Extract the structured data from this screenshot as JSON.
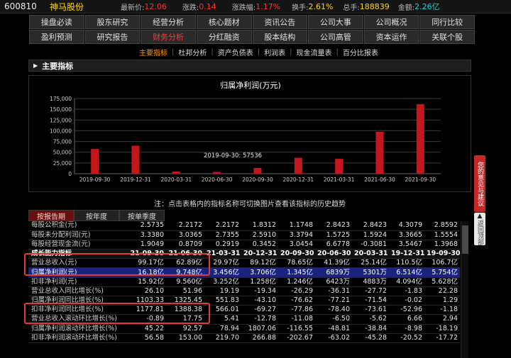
{
  "stock": {
    "code": "600810",
    "name": "神马股份",
    "price_label": "最新价:",
    "price": "12.06",
    "change_label": "涨跌:",
    "change": "0.14",
    "change_pct_label": "涨跌幅:",
    "change_pct": "1.17%",
    "turnover_label": "换手:",
    "turnover": "2.61%",
    "total_hands_label": "总手:",
    "total_hands": "188839",
    "amount_label": "金额:",
    "amount": "2.26亿"
  },
  "nav": {
    "row1": [
      "操盘必读",
      "股东研究",
      "经营分析",
      "核心题材",
      "资讯公告",
      "公司大事",
      "公司概况",
      "同行比较"
    ],
    "row2": [
      "盈利预测",
      "研究报告",
      "财务分析",
      "分红融资",
      "股本结构",
      "公司高管",
      "资本运作",
      "关联个股"
    ],
    "active": "财务分析"
  },
  "subnav": {
    "items": [
      "主要指标",
      "杜邦分析",
      "资产负债表",
      "利润表",
      "现金流量表",
      "百分比报表"
    ],
    "active": "主要指标"
  },
  "section_title": "主要指标",
  "chart_data": {
    "type": "bar",
    "title": "归属净利润(万元)",
    "categories": [
      "2019-09-30",
      "2019-12-31",
      "2020-03-31",
      "2020-06-30",
      "2020-09-30",
      "2020-12-31",
      "2021-03-31",
      "2021-06-30",
      "2021-09-30"
    ],
    "values": [
      57536,
      65000,
      5000,
      4000,
      13450,
      37060,
      34560,
      97480,
      162000
    ],
    "y_ticks": [
      "0",
      "25,000",
      "50,000",
      "75,000",
      "100,000",
      "125,000",
      "150,000",
      "175,000"
    ],
    "ylim": [
      0,
      175000
    ],
    "tooltip": "2019-09-30: 57536",
    "bar_color": "#c4161c",
    "grid": true
  },
  "note": "注：点击表格内的指标名称可切换图片查看该指标的历史趋势",
  "tabs": {
    "items": [
      "按报告期",
      "按年度",
      "按单季度"
    ],
    "active": "按报告期"
  },
  "table": {
    "rows": [
      {
        "name": "每股公积金(元)",
        "values": [
          "2.5735",
          "2.2172",
          "2.2172",
          "1.8312",
          "1.1748",
          "2.8423",
          "2.8423",
          "4.3079",
          "2.8592"
        ]
      },
      {
        "name": "每股未分配利润(元)",
        "values": [
          "3.3380",
          "3.0365",
          "2.7355",
          "2.5910",
          "3.3794",
          "1.5725",
          "1.5924",
          "3.3665",
          "1.5554"
        ]
      },
      {
        "name": "每股经营现金流(元)",
        "values": [
          "1.9049",
          "0.8709",
          "0.2919",
          "0.3452",
          "3.0454",
          "6.6778",
          "-0.3081",
          "3.5467",
          "1.3968"
        ]
      },
      {
        "name": "成长能力指标",
        "header": true,
        "values": [
          "21-09-30",
          "21-06-30",
          "21-03-31",
          "20-12-31",
          "20-09-30",
          "20-06-30",
          "20-03-31",
          "19-12-31",
          "19-09-30"
        ]
      },
      {
        "name": "营业总收入(元)",
        "values": [
          "99.17亿",
          "62.89亿",
          "29.97亿",
          "89.12亿",
          "78.65亿",
          "41.39亿",
          "25.14亿",
          "110.5亿",
          "106.7亿"
        ]
      },
      {
        "name": "归属净利润(元)",
        "highlight": true,
        "values": [
          "16.18亿",
          "9.748亿",
          "3.456亿",
          "3.706亿",
          "1.345亿",
          "6839万",
          "5301万",
          "6.514亿",
          "5.754亿"
        ]
      },
      {
        "name": "扣非净利润(元)",
        "values": [
          "15.92亿",
          "9.560亿",
          "3.252亿",
          "1.258亿",
          "1.246亿",
          "6423万",
          "4883万",
          "4.094亿",
          "5.628亿"
        ]
      },
      {
        "name": "营业总收入同比增长(%)",
        "values": [
          "26.10",
          "51.96",
          "19.19",
          "-19.34",
          "-26.29",
          "-36.31",
          "-27.72",
          "-1.83",
          "22.28"
        ]
      },
      {
        "name": "归属净利润同比增长(%)",
        "values": [
          "1103.33",
          "1325.45",
          "551.83",
          "-43.10",
          "-76.62",
          "-77.21",
          "-71.54",
          "-0.02",
          "1.29"
        ]
      },
      {
        "name": "扣非净利润同比增长(%)",
        "values": [
          "1177.81",
          "1388.38",
          "566.01",
          "-69.27",
          "-77.86",
          "-78.40",
          "-73.61",
          "-52.96",
          "-1.18"
        ]
      },
      {
        "name": "营业总收入滚动环比增长(%)",
        "values": [
          "-0.89",
          "17.75",
          "5.41",
          "-12.78",
          "-11.08",
          "-6.50",
          "-5.62",
          "6.66",
          "2.94"
        ]
      },
      {
        "name": "归属净利润滚动环比增长(%)",
        "values": [
          "45.22",
          "92.57",
          "78.94",
          "1807.06",
          "-116.55",
          "-48.81",
          "-38.84",
          "-8.98",
          "-18.19"
        ]
      },
      {
        "name": "扣非净利润滚动环比增长(%)",
        "values": [
          "56.58",
          "153.00",
          "219.70",
          "266.88",
          "-202.67",
          "-63.02",
          "-45.28",
          "-20.52",
          "-17.72"
        ]
      }
    ]
  },
  "side": {
    "feedback": "您的意见与建议",
    "backtop": "返回顶部"
  }
}
